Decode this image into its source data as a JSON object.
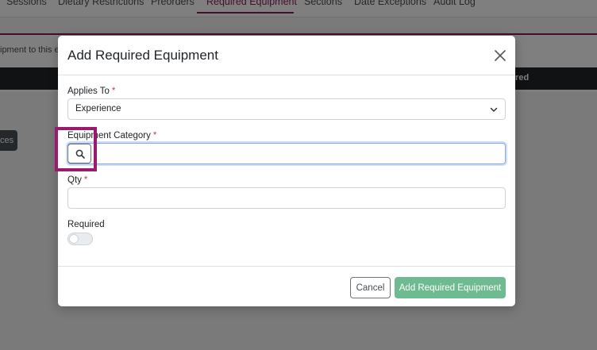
{
  "background": {
    "tabs": [
      {
        "label": "Sessions",
        "active": false
      },
      {
        "label": "Dietary Restrictions",
        "active": false
      },
      {
        "label": "Preorders",
        "active": false
      },
      {
        "label": "Required Equipment",
        "active": true
      },
      {
        "label": "Sections",
        "active": false
      },
      {
        "label": "Date Exceptions",
        "active": false
      },
      {
        "label": "Audit Log",
        "active": false
      }
    ],
    "hint_text": "ipment to this e",
    "table_header_label": "ired",
    "partial_button_label": "ces"
  },
  "modal": {
    "title": "Add Required Equipment",
    "applies_to": {
      "label": "Applies To",
      "required_mark": "*",
      "value": "Experience"
    },
    "equipment_category": {
      "label": "Equipment Category",
      "required_mark": "*",
      "value": ""
    },
    "qty": {
      "label": "Qty",
      "required_mark": "*",
      "value": ""
    },
    "required": {
      "label": "Required",
      "checked": false
    },
    "buttons": {
      "cancel": "Cancel",
      "submit": "Add Required Equipment"
    }
  },
  "icons": {
    "close": "close-icon",
    "chevron": "chevron-down-icon",
    "search": "search-icon"
  },
  "colors": {
    "accent": "#8a1c5c",
    "highlight": "#9c1a6c",
    "submit": "#6fbb91",
    "required_mark": "#dc3545"
  }
}
